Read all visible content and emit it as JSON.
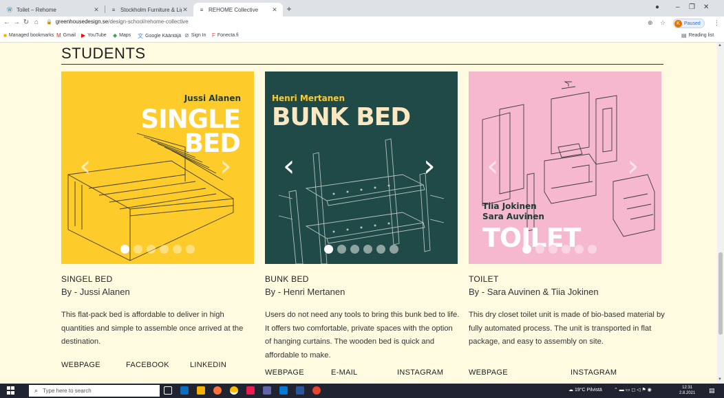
{
  "browser": {
    "tabs": [
      {
        "title": "Toilet – Rehome",
        "active": false
      },
      {
        "title": "Stockholm Furniture & Light Fai",
        "active": false
      },
      {
        "title": "REHOME Collective",
        "active": true
      }
    ],
    "url_host": "greenhousedesign.se",
    "url_path": "/design-school/rehome-collective",
    "profile_initial": "K",
    "profile_label": "Paused",
    "bookmarks": [
      {
        "label": "Managed bookmarks",
        "icon": "folder-icon",
        "color": "#f9ab00"
      },
      {
        "label": "Gmail",
        "icon": "gmail-icon",
        "color": "#d93025"
      },
      {
        "label": "YouTube",
        "icon": "youtube-icon",
        "color": "#ff0000"
      },
      {
        "label": "Maps",
        "icon": "maps-icon",
        "color": "#34a853"
      },
      {
        "label": "Google Kääntäjä",
        "icon": "translate-icon",
        "color": "#4285f4"
      },
      {
        "label": "Sign In",
        "icon": "signin-icon",
        "color": "#5f6368"
      },
      {
        "label": "Fonecta.fi",
        "icon": "fonecta-icon",
        "color": "#e8442e"
      }
    ],
    "reading_list": "Reading list"
  },
  "section": {
    "title": "STUDENTS"
  },
  "cards": [
    {
      "image_author": "Jussi Alanen",
      "image_title_line1": "SINGLE",
      "image_title_line2": "BED",
      "title": "SINGEL BED",
      "by": "By - Jussi Alanen",
      "description": "This flat-pack bed is affordable to deliver in high quantities and simple to assemble once arrived at the destination.",
      "links": [
        "WEBPAGE",
        "FACEBOOK",
        "LINKEDIN"
      ],
      "bg_color": "#fdcb2a",
      "text_color": "#ffffff",
      "author_color": "#1e3a36",
      "slides": 6
    },
    {
      "image_author": "Henri Mertanen",
      "image_title_line1": "BUNK BED",
      "title": "BUNK BED",
      "by": "By - Henri Mertanen",
      "description": "Users do not need any tools to bring this bunk bed to life. It offers two comfortable, private spaces with the option of hanging curtains. The wooden bed is quick and affordable to make.",
      "links": [
        "WEBPAGE",
        "E-MAIL",
        "INSTAGRAM"
      ],
      "bg_color": "#1f4a47",
      "text_color": "#fbe8c2",
      "author_color": "#fdcb2a",
      "slides": 6
    },
    {
      "image_author_line1": "Tiia Jokinen",
      "image_author_line2": "Sara Auvinen",
      "image_title_line1": "TOILET",
      "title": "TOILET",
      "by": "By - Sara Auvinen & Tiia Jokinen",
      "description": "This dry closet toilet unit is made of bio-based material by fully automated process. The unit is transported in flat package, and easy to assembly on site.",
      "links": [
        "WEBPAGE",
        "INSTAGRAM"
      ],
      "bg_color": "#f5b8cf",
      "text_color": "#ffffff",
      "author_color": "#1e3a36",
      "slides": 6
    }
  ],
  "taskbar": {
    "search_placeholder": "Type here to search",
    "weather": "19°C Pilvistä",
    "time": "12:31",
    "date": "2.8.2021"
  }
}
